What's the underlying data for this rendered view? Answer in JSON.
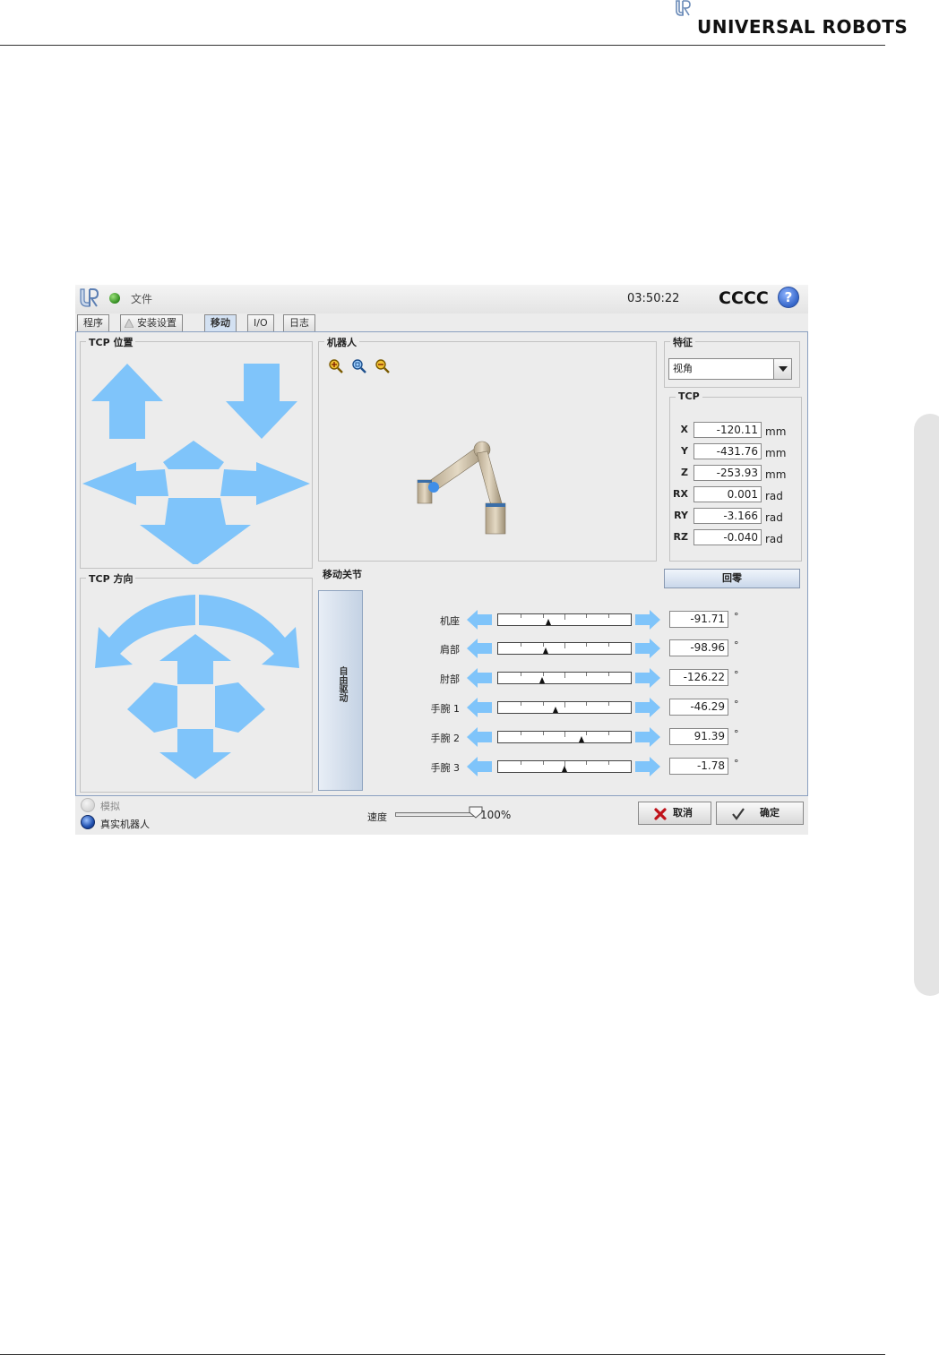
{
  "page_header": {
    "brand": "UNIVERSAL ROBOTS"
  },
  "app": {
    "file_label": "文件",
    "time": "03:50:22",
    "robot_name": "CCCC",
    "help": "?"
  },
  "tabs": [
    {
      "label": "程序",
      "active": false
    },
    {
      "label": "安装设置",
      "active": false
    },
    {
      "label": "移动",
      "active": true
    },
    {
      "label": "I/O",
      "active": false
    },
    {
      "label": "日志",
      "active": false
    }
  ],
  "panels": {
    "tcp_position": "TCP 位置",
    "tcp_orientation": "TCP 方向",
    "robot": "机器人",
    "feature": "特征",
    "tcp": "TCP",
    "move_joints": "移动关节"
  },
  "feature_select": {
    "value": "视角"
  },
  "tcp_values": [
    {
      "label": "X",
      "value": "-120.11",
      "unit": "mm"
    },
    {
      "label": "Y",
      "value": "-431.76",
      "unit": "mm"
    },
    {
      "label": "Z",
      "value": "-253.93",
      "unit": "mm"
    },
    {
      "label": "RX",
      "value": "0.001",
      "unit": "rad"
    },
    {
      "label": "RY",
      "value": "-3.166",
      "unit": "rad"
    },
    {
      "label": "RZ",
      "value": "-0.040",
      "unit": "rad"
    }
  ],
  "home_button": "回零",
  "freedrive_button": "自由驱动",
  "joints": [
    {
      "label": "机座",
      "value": "-91.71",
      "unit": "°",
      "position": 0.38
    },
    {
      "label": "肩部",
      "value": "-98.96",
      "unit": "°",
      "position": 0.36
    },
    {
      "label": "肘部",
      "value": "-126.22",
      "unit": "°",
      "position": 0.33
    },
    {
      "label": "手腕 1",
      "value": "-46.29",
      "unit": "°",
      "position": 0.43
    },
    {
      "label": "手腕 2",
      "value": "91.39",
      "unit": "°",
      "position": 0.63
    },
    {
      "label": "手腕 3",
      "value": "-1.78",
      "unit": "°",
      "position": 0.5
    }
  ],
  "footer": {
    "simulate": "模拟",
    "real_robot": "真实机器人",
    "speed_label": "速度",
    "speed_value": "100%",
    "speed_fraction": 1.0,
    "cancel": "取消",
    "ok": "确定"
  },
  "colors": {
    "arrow": "#7fc4fa",
    "status_ok": "#2f8a1e"
  }
}
